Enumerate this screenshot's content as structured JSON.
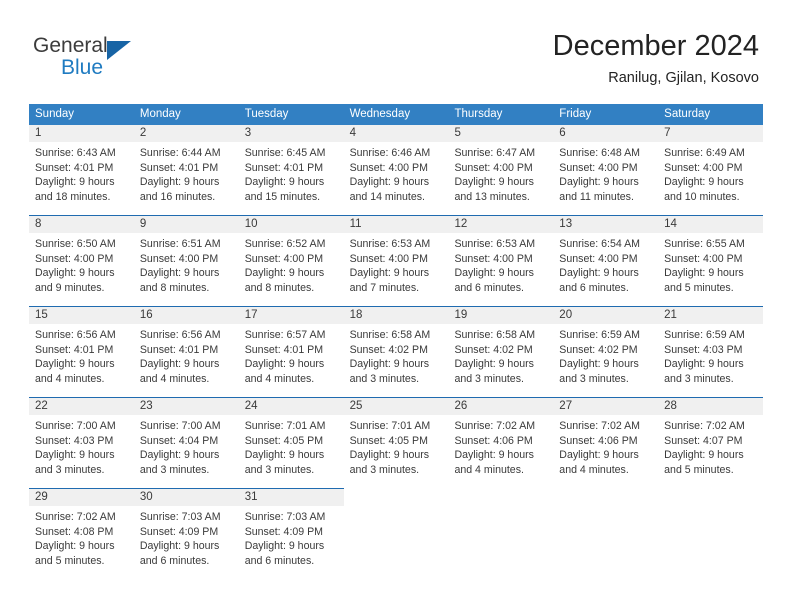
{
  "brand": {
    "name_part1": "General",
    "name_part2": "Blue",
    "triangle_color": "#1764a5",
    "blue_color": "#1f7bc1"
  },
  "header": {
    "title": "December 2024",
    "subtitle": "Ranilug, Gjilan, Kosovo"
  },
  "theme": {
    "header_bg": "#3280c3",
    "row_border": "#1f6bb0",
    "date_bg": "#f0f0f0",
    "text": "#3a3a3a"
  },
  "weekday_headers": [
    "Sunday",
    "Monday",
    "Tuesday",
    "Wednesday",
    "Thursday",
    "Friday",
    "Saturday"
  ],
  "weeks": [
    [
      {
        "date": "1",
        "sunrise": "Sunrise: 6:43 AM",
        "sunset": "Sunset: 4:01 PM",
        "daylight1": "Daylight: 9 hours",
        "daylight2": "and 18 minutes."
      },
      {
        "date": "2",
        "sunrise": "Sunrise: 6:44 AM",
        "sunset": "Sunset: 4:01 PM",
        "daylight1": "Daylight: 9 hours",
        "daylight2": "and 16 minutes."
      },
      {
        "date": "3",
        "sunrise": "Sunrise: 6:45 AM",
        "sunset": "Sunset: 4:01 PM",
        "daylight1": "Daylight: 9 hours",
        "daylight2": "and 15 minutes."
      },
      {
        "date": "4",
        "sunrise": "Sunrise: 6:46 AM",
        "sunset": "Sunset: 4:00 PM",
        "daylight1": "Daylight: 9 hours",
        "daylight2": "and 14 minutes."
      },
      {
        "date": "5",
        "sunrise": "Sunrise: 6:47 AM",
        "sunset": "Sunset: 4:00 PM",
        "daylight1": "Daylight: 9 hours",
        "daylight2": "and 13 minutes."
      },
      {
        "date": "6",
        "sunrise": "Sunrise: 6:48 AM",
        "sunset": "Sunset: 4:00 PM",
        "daylight1": "Daylight: 9 hours",
        "daylight2": "and 11 minutes."
      },
      {
        "date": "7",
        "sunrise": "Sunrise: 6:49 AM",
        "sunset": "Sunset: 4:00 PM",
        "daylight1": "Daylight: 9 hours",
        "daylight2": "and 10 minutes."
      }
    ],
    [
      {
        "date": "8",
        "sunrise": "Sunrise: 6:50 AM",
        "sunset": "Sunset: 4:00 PM",
        "daylight1": "Daylight: 9 hours",
        "daylight2": "and 9 minutes."
      },
      {
        "date": "9",
        "sunrise": "Sunrise: 6:51 AM",
        "sunset": "Sunset: 4:00 PM",
        "daylight1": "Daylight: 9 hours",
        "daylight2": "and 8 minutes."
      },
      {
        "date": "10",
        "sunrise": "Sunrise: 6:52 AM",
        "sunset": "Sunset: 4:00 PM",
        "daylight1": "Daylight: 9 hours",
        "daylight2": "and 8 minutes."
      },
      {
        "date": "11",
        "sunrise": "Sunrise: 6:53 AM",
        "sunset": "Sunset: 4:00 PM",
        "daylight1": "Daylight: 9 hours",
        "daylight2": "and 7 minutes."
      },
      {
        "date": "12",
        "sunrise": "Sunrise: 6:53 AM",
        "sunset": "Sunset: 4:00 PM",
        "daylight1": "Daylight: 9 hours",
        "daylight2": "and 6 minutes."
      },
      {
        "date": "13",
        "sunrise": "Sunrise: 6:54 AM",
        "sunset": "Sunset: 4:00 PM",
        "daylight1": "Daylight: 9 hours",
        "daylight2": "and 6 minutes."
      },
      {
        "date": "14",
        "sunrise": "Sunrise: 6:55 AM",
        "sunset": "Sunset: 4:00 PM",
        "daylight1": "Daylight: 9 hours",
        "daylight2": "and 5 minutes."
      }
    ],
    [
      {
        "date": "15",
        "sunrise": "Sunrise: 6:56 AM",
        "sunset": "Sunset: 4:01 PM",
        "daylight1": "Daylight: 9 hours",
        "daylight2": "and 4 minutes."
      },
      {
        "date": "16",
        "sunrise": "Sunrise: 6:56 AM",
        "sunset": "Sunset: 4:01 PM",
        "daylight1": "Daylight: 9 hours",
        "daylight2": "and 4 minutes."
      },
      {
        "date": "17",
        "sunrise": "Sunrise: 6:57 AM",
        "sunset": "Sunset: 4:01 PM",
        "daylight1": "Daylight: 9 hours",
        "daylight2": "and 4 minutes."
      },
      {
        "date": "18",
        "sunrise": "Sunrise: 6:58 AM",
        "sunset": "Sunset: 4:02 PM",
        "daylight1": "Daylight: 9 hours",
        "daylight2": "and 3 minutes."
      },
      {
        "date": "19",
        "sunrise": "Sunrise: 6:58 AM",
        "sunset": "Sunset: 4:02 PM",
        "daylight1": "Daylight: 9 hours",
        "daylight2": "and 3 minutes."
      },
      {
        "date": "20",
        "sunrise": "Sunrise: 6:59 AM",
        "sunset": "Sunset: 4:02 PM",
        "daylight1": "Daylight: 9 hours",
        "daylight2": "and 3 minutes."
      },
      {
        "date": "21",
        "sunrise": "Sunrise: 6:59 AM",
        "sunset": "Sunset: 4:03 PM",
        "daylight1": "Daylight: 9 hours",
        "daylight2": "and 3 minutes."
      }
    ],
    [
      {
        "date": "22",
        "sunrise": "Sunrise: 7:00 AM",
        "sunset": "Sunset: 4:03 PM",
        "daylight1": "Daylight: 9 hours",
        "daylight2": "and 3 minutes."
      },
      {
        "date": "23",
        "sunrise": "Sunrise: 7:00 AM",
        "sunset": "Sunset: 4:04 PM",
        "daylight1": "Daylight: 9 hours",
        "daylight2": "and 3 minutes."
      },
      {
        "date": "24",
        "sunrise": "Sunrise: 7:01 AM",
        "sunset": "Sunset: 4:05 PM",
        "daylight1": "Daylight: 9 hours",
        "daylight2": "and 3 minutes."
      },
      {
        "date": "25",
        "sunrise": "Sunrise: 7:01 AM",
        "sunset": "Sunset: 4:05 PM",
        "daylight1": "Daylight: 9 hours",
        "daylight2": "and 3 minutes."
      },
      {
        "date": "26",
        "sunrise": "Sunrise: 7:02 AM",
        "sunset": "Sunset: 4:06 PM",
        "daylight1": "Daylight: 9 hours",
        "daylight2": "and 4 minutes."
      },
      {
        "date": "27",
        "sunrise": "Sunrise: 7:02 AM",
        "sunset": "Sunset: 4:06 PM",
        "daylight1": "Daylight: 9 hours",
        "daylight2": "and 4 minutes."
      },
      {
        "date": "28",
        "sunrise": "Sunrise: 7:02 AM",
        "sunset": "Sunset: 4:07 PM",
        "daylight1": "Daylight: 9 hours",
        "daylight2": "and 5 minutes."
      }
    ],
    [
      {
        "date": "29",
        "sunrise": "Sunrise: 7:02 AM",
        "sunset": "Sunset: 4:08 PM",
        "daylight1": "Daylight: 9 hours",
        "daylight2": "and 5 minutes."
      },
      {
        "date": "30",
        "sunrise": "Sunrise: 7:03 AM",
        "sunset": "Sunset: 4:09 PM",
        "daylight1": "Daylight: 9 hours",
        "daylight2": "and 6 minutes."
      },
      {
        "date": "31",
        "sunrise": "Sunrise: 7:03 AM",
        "sunset": "Sunset: 4:09 PM",
        "daylight1": "Daylight: 9 hours",
        "daylight2": "and 6 minutes."
      }
    ]
  ]
}
